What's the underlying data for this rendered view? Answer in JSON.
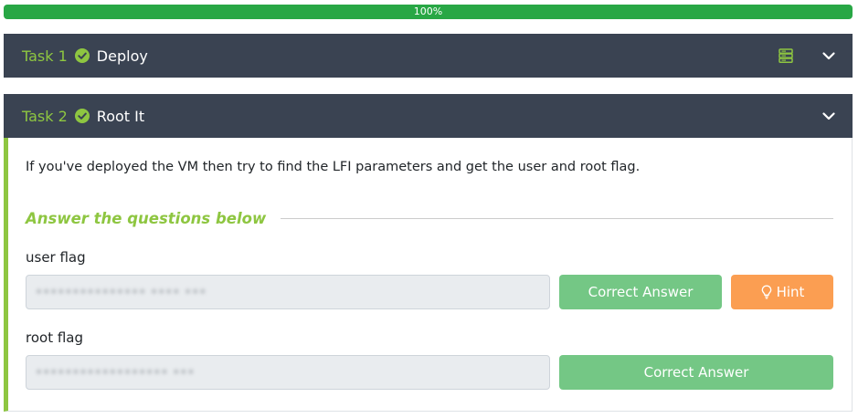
{
  "progress": {
    "label": "100%",
    "percent": 100
  },
  "tasks": [
    {
      "number": "Task 1",
      "title": "Deploy"
    },
    {
      "number": "Task 2",
      "title": "Root It",
      "description": "If you've deployed the VM then try to find the LFI parameters and get the user and root flag.",
      "answer_heading": "Answer the questions below",
      "questions": [
        {
          "label": "user flag",
          "value": "••••••••••••••• •••• •••",
          "button": "Correct Answer",
          "hint": "Hint"
        },
        {
          "label": "root flag",
          "value": "•••••••••••••••••• •••",
          "button": "Correct Answer"
        }
      ]
    }
  ],
  "colors": {
    "accent": "#8ec641",
    "header_bg": "#3a4352",
    "correct": "#74c785",
    "hint": "#fb9e52",
    "progress": "#28a745"
  },
  "icons": {
    "completed": "check-circle-icon",
    "server": "server-icon",
    "collapse": "chevron-down-icon",
    "hint": "lightbulb-icon"
  }
}
